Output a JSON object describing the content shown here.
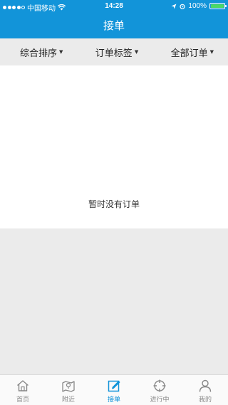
{
  "status_bar": {
    "carrier": "中国移动",
    "time": "14:28",
    "battery_pct": "100%",
    "battery_level": 1.0
  },
  "nav": {
    "title": "接单"
  },
  "filters": [
    {
      "label": "综合排序"
    },
    {
      "label": "订单标签"
    },
    {
      "label": "全部订单"
    }
  ],
  "empty_message": "暂时没有订单",
  "tabs": [
    {
      "label": "首页",
      "icon": "home-icon"
    },
    {
      "label": "附近",
      "icon": "map-icon"
    },
    {
      "label": "接单",
      "icon": "edit-icon",
      "active": true
    },
    {
      "label": "进行中",
      "icon": "target-icon"
    },
    {
      "label": "我的",
      "icon": "user-icon"
    }
  ],
  "colors": {
    "primary": "#1294d9",
    "battery": "#4cd964"
  }
}
